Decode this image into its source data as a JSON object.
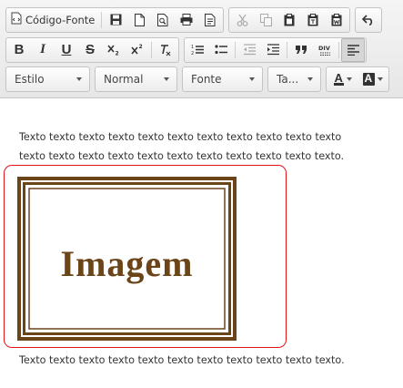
{
  "toolbar": {
    "source_label": "Código-Fonte",
    "styles": {
      "style_combo": "Estilo",
      "format_combo": "Normal",
      "font_combo": "Fonte",
      "size_combo": "Ta..."
    },
    "format_buttons": {
      "bold": "B",
      "italic": "I",
      "underline": "U",
      "strike": "S"
    },
    "text_color_letter": "A",
    "bg_color_letter": "A",
    "icons": [
      "source-icon",
      "save-icon",
      "new-page-icon",
      "preview-icon",
      "print-icon",
      "templates-icon",
      "cut-icon",
      "copy-icon",
      "paste-icon",
      "paste-text-icon",
      "paste-word-icon",
      "undo-icon",
      "bold-icon",
      "italic-icon",
      "underline-icon",
      "strikethrough-icon",
      "subscript-icon",
      "superscript-icon",
      "remove-format-icon",
      "numbered-list-icon",
      "bulleted-list-icon",
      "outdent-icon",
      "indent-icon",
      "blockquote-icon",
      "div-container-icon",
      "align-left-icon",
      "text-color-icon",
      "background-color-icon"
    ]
  },
  "colors": {
    "selection_border": "#e3151a",
    "image_frame": "#6b4418",
    "image_text": "#6b4418"
  },
  "content": {
    "paragraph1_line1": "Texto texto texto texto texto texto texto texto texto texto texto",
    "paragraph1_line2": "texto texto texto texto texto texto texto texto texto texto texto.",
    "image_text": "Imagem",
    "paragraph2": "Texto texto texto texto texto texto texto texto texto texto texto."
  }
}
